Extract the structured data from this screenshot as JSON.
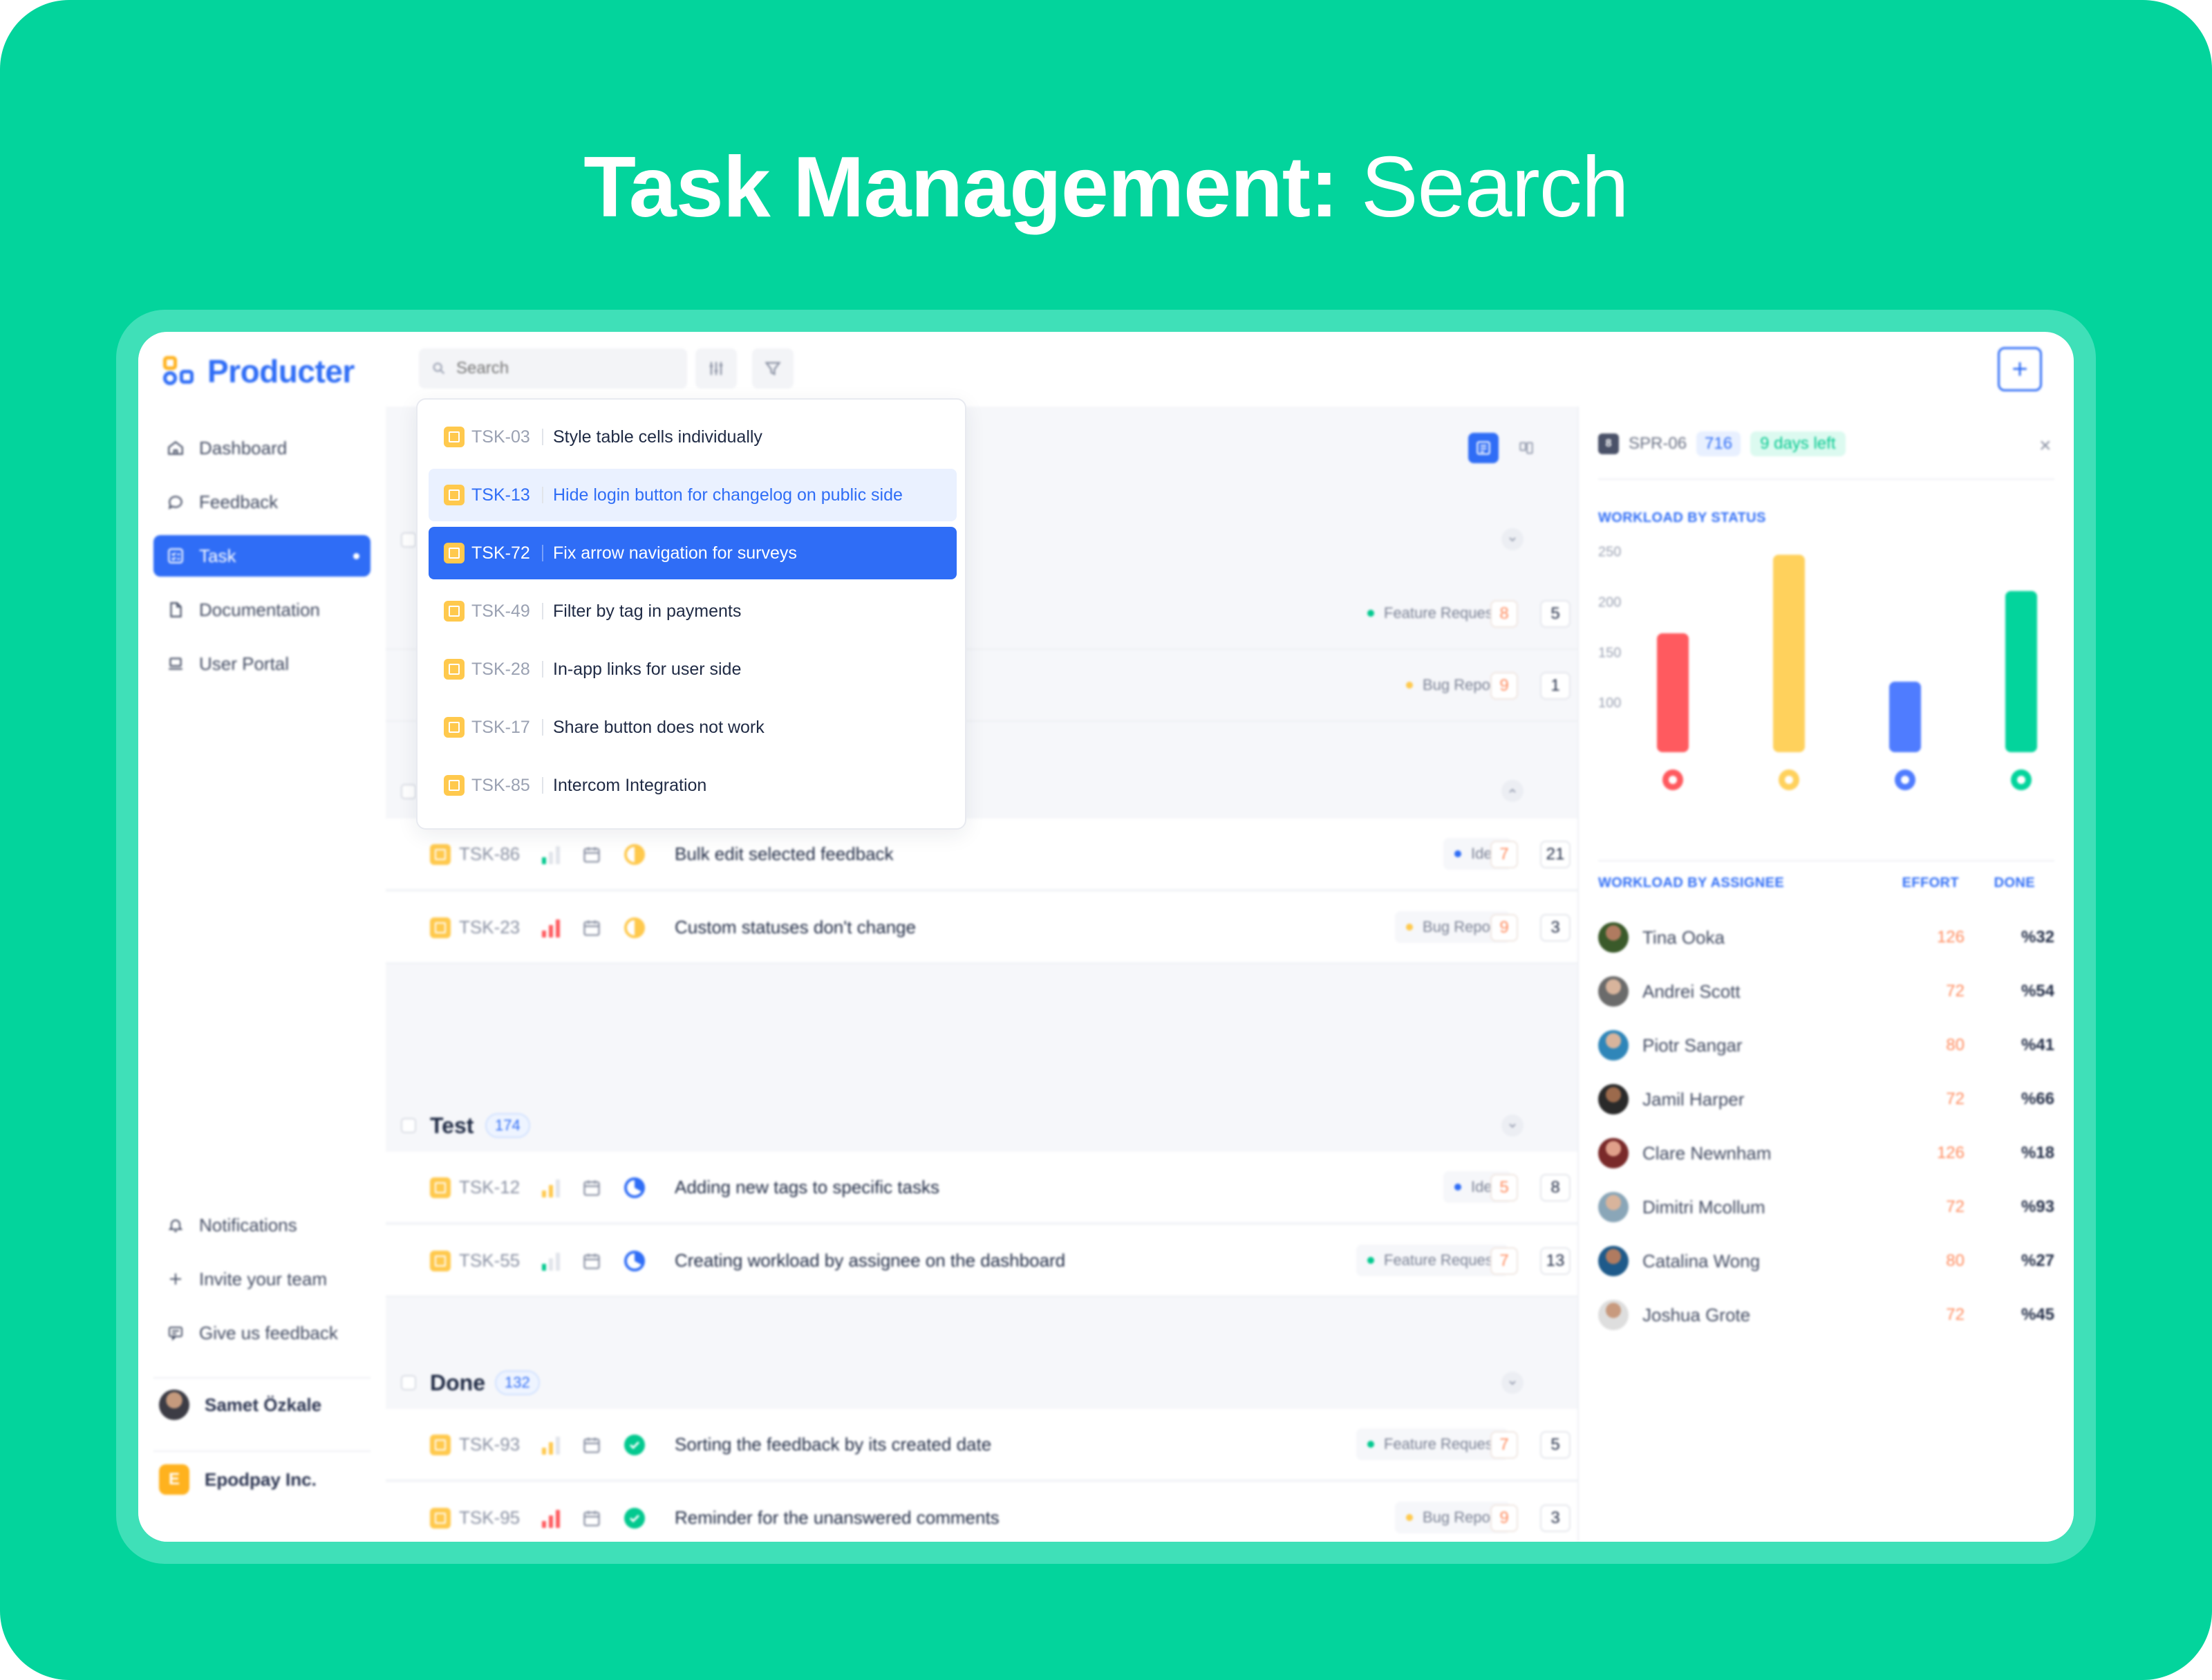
{
  "headline": {
    "bold": "Task Management:",
    "light": "Search"
  },
  "brand": {
    "name": "Producter"
  },
  "colors": {
    "background": "#03d49c",
    "accent": "#2f6df6",
    "effort": "#ff8a5c",
    "tag": "#ffc94d"
  },
  "sidebar": {
    "items": [
      {
        "label": "Dashboard",
        "icon": "home-icon"
      },
      {
        "label": "Feedback",
        "icon": "chat-bubble-icon"
      },
      {
        "label": "Task",
        "icon": "task-list-icon",
        "active": true
      },
      {
        "label": "Documentation",
        "icon": "document-icon"
      },
      {
        "label": "User Portal",
        "icon": "laptop-icon"
      }
    ],
    "bottom_items": [
      {
        "label": "Notifications",
        "icon": "bell-icon"
      },
      {
        "label": "Invite your team",
        "icon": "plus-icon"
      },
      {
        "label": "Give us feedback",
        "icon": "message-square-icon"
      }
    ],
    "user": {
      "name": "Samet Özkale"
    },
    "company": {
      "name": "Epodpay Inc.",
      "initial": "E"
    }
  },
  "topbar": {
    "search_placeholder": "Search",
    "add_label": "+"
  },
  "search_results": [
    {
      "id": "TSK-03",
      "title": "Style table cells individually",
      "state": "normal"
    },
    {
      "id": "TSK-13",
      "title": "Hide login button for changelog on public side",
      "state": "hover"
    },
    {
      "id": "TSK-72",
      "title": "Fix arrow navigation for surveys",
      "state": "selected"
    },
    {
      "id": "TSK-49",
      "title": "Filter by tag in payments",
      "state": "normal"
    },
    {
      "id": "TSK-28",
      "title": "In-app links for user side",
      "state": "normal"
    },
    {
      "id": "TSK-17",
      "title": "Share button does not work",
      "state": "normal"
    },
    {
      "id": "TSK-85",
      "title": "Intercom Integration",
      "state": "normal"
    }
  ],
  "groups": [
    {
      "title": "Test",
      "count": "174"
    },
    {
      "title": "Done",
      "count": "132"
    }
  ],
  "rows_hidden": [
    {
      "label": "Feature Request",
      "label_color": "#03c98f",
      "effort": "8",
      "subs": "5"
    },
    {
      "label": "Bug Report",
      "label_color": "#ffc94d",
      "effort": "9",
      "subs": "1"
    }
  ],
  "tasks": [
    {
      "id": "TSK-86",
      "title": "Bulk edit selected feedback",
      "label": "Idea",
      "label_color": "#2f6df6",
      "effort": "7",
      "subs": "21",
      "status": "half",
      "prio": "low"
    },
    {
      "id": "TSK-23",
      "title": "Custom statuses don't change",
      "label": "Bug Report",
      "label_color": "#ffc94d",
      "effort": "9",
      "subs": "3",
      "status": "half",
      "prio": "high"
    },
    {
      "id": "TSK-12",
      "title": "Adding new tags to specific tasks",
      "label": "Idea",
      "label_color": "#2f6df6",
      "effort": "5",
      "subs": "8",
      "status": "blue",
      "prio": "mid"
    },
    {
      "id": "TSK-55",
      "title": "Creating workload by assignee on the dashboard",
      "label": "Feature Request",
      "label_color": "#03c98f",
      "effort": "7",
      "subs": "13",
      "status": "blue",
      "prio": "low"
    },
    {
      "id": "TSK-93",
      "title": "Sorting the feedback by its created date",
      "label": "Feature Request",
      "label_color": "#03c98f",
      "effort": "7",
      "subs": "5",
      "status": "done",
      "prio": "mid"
    },
    {
      "id": "TSK-95",
      "title": "Reminder for the unanswered comments",
      "label": "Bug Report",
      "label_color": "#ffc94d",
      "effort": "9",
      "subs": "3",
      "status": "done",
      "prio": "high"
    }
  ],
  "panel": {
    "sprint_icon": "8",
    "sprint_id": "SPR-06",
    "sprint_num": "716",
    "days_left": "9 days left",
    "close": "×",
    "workload_title": "WORKLOAD BY STATUS",
    "assignee_title": "WORKLOAD BY ASSIGNEE",
    "effort_header": "EFFORT",
    "done_header": "DONE",
    "assignees": [
      {
        "name": "Tina Ooka",
        "effort": "126",
        "done": "%32"
      },
      {
        "name": "Andrei Scott",
        "effort": "72",
        "done": "%54"
      },
      {
        "name": "Piotr Sangar",
        "effort": "80",
        "done": "%41"
      },
      {
        "name": "Jamil Harper",
        "effort": "72",
        "done": "%66"
      },
      {
        "name": "Clare Newnham",
        "effort": "126",
        "done": "%18"
      },
      {
        "name": "Dimitri Mcollum",
        "effort": "72",
        "done": "%93"
      },
      {
        "name": "Catalina Wong",
        "effort": "80",
        "done": "%27"
      },
      {
        "name": "Joshua Grote",
        "effort": "72",
        "done": "%45"
      }
    ]
  },
  "chart_data": {
    "type": "bar",
    "title": "WORKLOAD BY STATUS",
    "categories": [
      "",
      "",
      "",
      ""
    ],
    "values": [
      168,
      246,
      120,
      210
    ],
    "colors": [
      "#ff5a5f",
      "#ffd15c",
      "#4f7cff",
      "#03d49c"
    ],
    "yticks": [
      100,
      150,
      200,
      250
    ],
    "ylim": [
      50,
      260
    ]
  }
}
